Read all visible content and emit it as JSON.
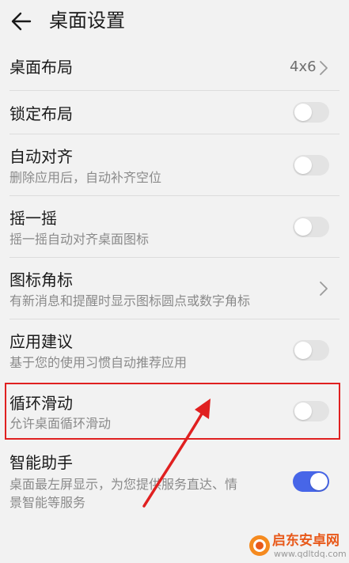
{
  "header": {
    "title": "桌面设置",
    "back_icon": "arrow-left-icon"
  },
  "settings": {
    "layout": {
      "label": "桌面布局",
      "value": "4x6"
    },
    "lock_layout": {
      "label": "锁定布局",
      "enabled": false
    },
    "auto_align": {
      "label": "自动对齐",
      "description": "删除应用后，自动补齐空位",
      "enabled": false
    },
    "shake": {
      "label": "摇一摇",
      "description": "摇一摇自动对齐桌面图标",
      "enabled": false
    },
    "icon_badge": {
      "label": "图标角标",
      "description": "有新消息和提醒时显示图标圆点或数字角标"
    },
    "app_suggest": {
      "label": "应用建议",
      "description": "基于您的使用习惯自动推荐应用",
      "enabled": false
    },
    "loop_scroll": {
      "label": "循环滑动",
      "description": "允许桌面循环滑动",
      "enabled": false
    },
    "smart_assistant": {
      "label": "智能助手",
      "description_line1": "桌面最左屏显示，为您提供服务直达、情",
      "description_line2": "景智能等服务",
      "enabled": true
    }
  },
  "watermark": {
    "title": "启东安卓网",
    "url": "www.qdltdq.com"
  },
  "colors": {
    "toggle_off": "#e3e3e3",
    "toggle_on": "#4766e8",
    "highlight": "#e02020"
  }
}
